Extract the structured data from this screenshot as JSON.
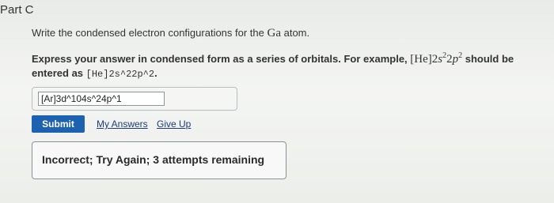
{
  "part": {
    "title": "Part C"
  },
  "question": {
    "text_prefix": "Write the condensed electron configurations for the ",
    "element": "Ga",
    "text_suffix": " atom."
  },
  "instructions": {
    "text": "Express your answer in condensed form as a series of orbitals. For example, ",
    "example_core": "[He]2",
    "example_s": "s",
    "example_s_exp": "2",
    "example_mid": "2",
    "example_p": "p",
    "example_p_exp": "2",
    "should_be": " should be entered as ",
    "entered_as": "[He]2s^22p^2",
    "period": "."
  },
  "answer": {
    "value": "[Ar]3d^104s^24p^1"
  },
  "actions": {
    "submit_label": "Submit",
    "my_answers_label": "My Answers",
    "give_up_label": "Give Up"
  },
  "feedback": {
    "text": "Incorrect; Try Again; 3 attempts remaining"
  },
  "colors": {
    "submit_bg": "#1c62b1",
    "link": "#1a3e7a"
  }
}
